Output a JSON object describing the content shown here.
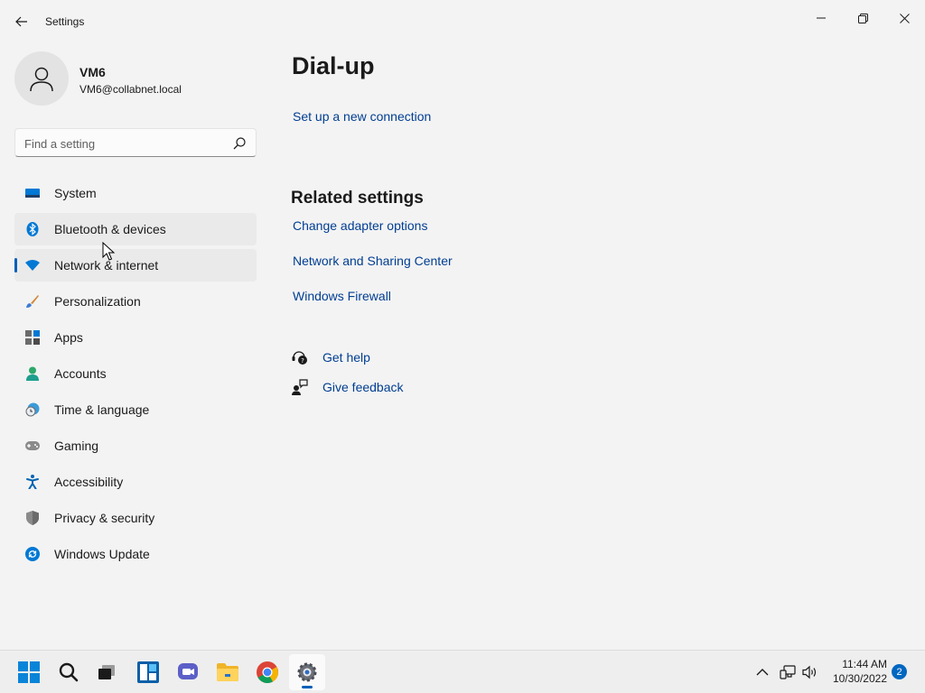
{
  "window": {
    "title": "Settings",
    "controls": {
      "minimize": "minimize-icon",
      "maximize": "restore-icon",
      "close": "close-icon"
    }
  },
  "profile": {
    "name": "VM6",
    "email": "VM6@collabnet.local"
  },
  "search": {
    "placeholder": "Find a setting",
    "value": ""
  },
  "sidebar": {
    "items": [
      {
        "label": "System",
        "icon": "system-icon",
        "state": "normal"
      },
      {
        "label": "Bluetooth & devices",
        "icon": "bluetooth-icon",
        "state": "hover"
      },
      {
        "label": "Network & internet",
        "icon": "wifi-icon",
        "state": "selected"
      },
      {
        "label": "Personalization",
        "icon": "brush-icon",
        "state": "normal"
      },
      {
        "label": "Apps",
        "icon": "apps-icon",
        "state": "normal"
      },
      {
        "label": "Accounts",
        "icon": "accounts-icon",
        "state": "normal"
      },
      {
        "label": "Time & language",
        "icon": "clock-globe-icon",
        "state": "normal"
      },
      {
        "label": "Gaming",
        "icon": "gamepad-icon",
        "state": "normal"
      },
      {
        "label": "Accessibility",
        "icon": "accessibility-icon",
        "state": "normal"
      },
      {
        "label": "Privacy & security",
        "icon": "shield-icon",
        "state": "normal"
      },
      {
        "label": "Windows Update",
        "icon": "update-icon",
        "state": "normal"
      }
    ]
  },
  "main": {
    "title": "Dial-up",
    "setup_link": "Set up a new connection",
    "related": {
      "title": "Related settings",
      "links": [
        "Change adapter options",
        "Network and Sharing Center",
        "Windows Firewall"
      ]
    },
    "help": {
      "get_help": "Get help",
      "give_feedback": "Give feedback"
    }
  },
  "taskbar": {
    "apps": [
      "start-icon",
      "search-icon",
      "task-view-icon",
      "widgets-icon",
      "chat-icon",
      "file-explorer-icon",
      "chrome-icon",
      "settings-icon"
    ],
    "active_app": "settings-icon",
    "tray": [
      "chevron-up-icon",
      "network-icon",
      "volume-icon"
    ],
    "time": "11:44 AM",
    "date": "10/30/2022",
    "notifications": "2"
  },
  "colors": {
    "accent": "#005fb8",
    "link": "#003e92",
    "background": "#f3f3f3"
  }
}
